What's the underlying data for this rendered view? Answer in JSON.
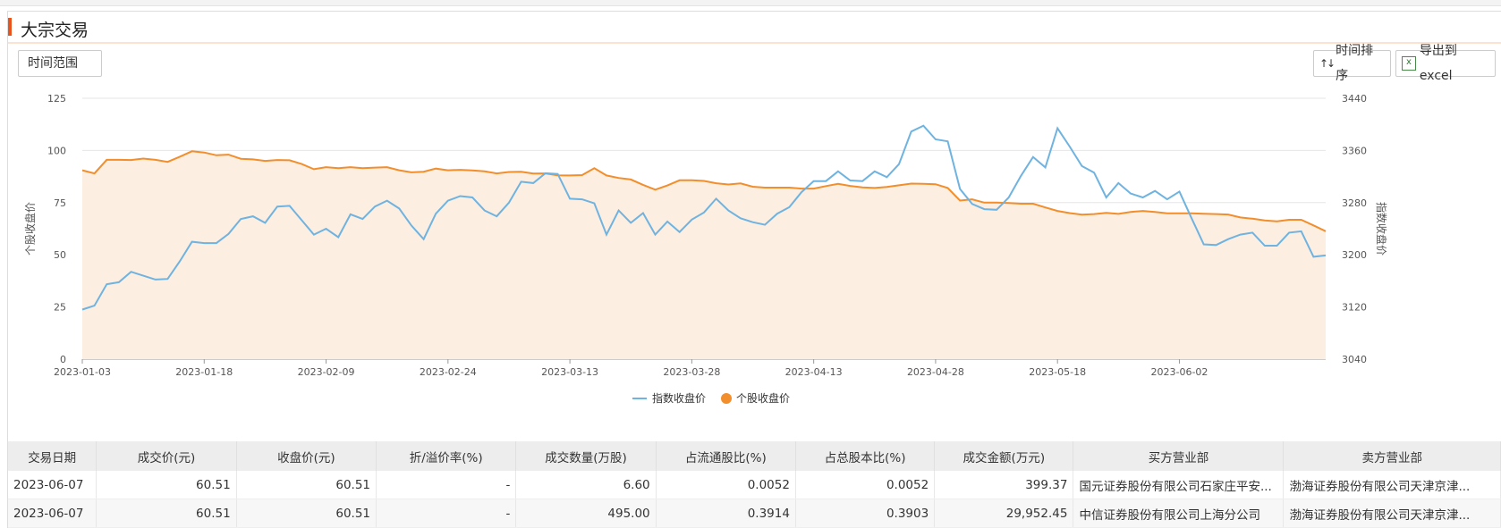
{
  "title": "大宗交易",
  "buttons": {
    "time_range": "时间范围",
    "sort": "时间排序",
    "export": "导出到excel"
  },
  "colors": {
    "accent": "#e8541e",
    "index_line": "#6fb3e0",
    "stock_line": "#f28e2b",
    "stock_area": "#fdeee2"
  },
  "chart_data": {
    "type": "line",
    "y_left": {
      "label": "个股收盘价",
      "range": [
        0,
        125
      ],
      "ticks": [
        0,
        25,
        50,
        75,
        100,
        125
      ]
    },
    "y_right": {
      "label": "指数收盘价",
      "range": [
        3040,
        3440
      ],
      "ticks": [
        3040,
        3120,
        3200,
        3280,
        3360,
        3440
      ]
    },
    "x_tick_labels": [
      "2023-01-03",
      "2023-01-18",
      "2023-02-09",
      "2023-02-24",
      "2023-03-13",
      "2023-03-28",
      "2023-04-13",
      "2023-04-28",
      "2023-05-18",
      "2023-06-02"
    ],
    "x_tick_positions": [
      0,
      10,
      20,
      30,
      40,
      50,
      60,
      70,
      80,
      90
    ],
    "grid": true,
    "legend_placement": "bottom",
    "series": [
      {
        "name": "指数收盘价",
        "axis": "right",
        "values": [
          3116,
          3122,
          3155,
          3158,
          3174,
          3168,
          3162,
          3163,
          3190,
          3220,
          3218,
          3218,
          3232,
          3255,
          3259,
          3249,
          3274,
          3275,
          3253,
          3231,
          3240,
          3227,
          3262,
          3255,
          3274,
          3283,
          3271,
          3245,
          3224,
          3263,
          3283,
          3290,
          3288,
          3268,
          3259,
          3280,
          3312,
          3310,
          3325,
          3324,
          3286,
          3285,
          3279,
          3231,
          3268,
          3249,
          3264,
          3231,
          3251,
          3235,
          3254,
          3265,
          3286,
          3268,
          3256,
          3250,
          3246,
          3263,
          3273,
          3296,
          3313,
          3313,
          3328,
          3314,
          3313,
          3328,
          3319,
          3339,
          3389,
          3398,
          3377,
          3374,
          3301,
          3278,
          3270,
          3269,
          3288,
          3321,
          3350,
          3334,
          3394,
          3366,
          3336,
          3326,
          3288,
          3310,
          3294,
          3288,
          3298,
          3285,
          3297,
          3256,
          3216,
          3215,
          3224,
          3231,
          3234,
          3214,
          3214,
          3234,
          3236,
          3197,
          3199
        ]
      },
      {
        "name": "个股收盘价",
        "axis": "left",
        "values": [
          90.5,
          89.0,
          95.5,
          95.5,
          95.4,
          96.1,
          95.5,
          94.5,
          97.0,
          99.6,
          99.0,
          97.7,
          98.0,
          96.0,
          95.7,
          95.0,
          95.4,
          95.3,
          93.5,
          91.0,
          92.0,
          91.5,
          92.0,
          91.5,
          91.8,
          92.0,
          90.5,
          89.5,
          89.8,
          91.3,
          90.5,
          90.7,
          90.4,
          90.0,
          89.0,
          89.7,
          89.8,
          88.9,
          89.0,
          88.1,
          88.0,
          88.2,
          91.5,
          88.0,
          86.8,
          86.1,
          83.5,
          81.2,
          83.2,
          85.7,
          85.7,
          85.4,
          84.3,
          83.7,
          84.2,
          82.6,
          82.2,
          82.2,
          82.2,
          81.7,
          81.7,
          82.9,
          84.0,
          83.0,
          82.3,
          82.0,
          82.5,
          83.3,
          84.1,
          84.0,
          83.8,
          82.0,
          76.0,
          76.6,
          75.0,
          75.0,
          74.8,
          74.5,
          74.5,
          72.7,
          71.0,
          70.0,
          69.2,
          69.5,
          70.1,
          69.6,
          70.5,
          71.0,
          70.5,
          69.9,
          69.9,
          69.9,
          69.7,
          69.5,
          69.3,
          67.9,
          67.3,
          66.5,
          66.0,
          66.8,
          66.8,
          64.1,
          61.3
        ]
      }
    ]
  },
  "table": {
    "columns": [
      "交易日期",
      "成交价(元)",
      "收盘价(元)",
      "折/溢价率(%)",
      "成交数量(万股)",
      "占流通股比(%)",
      "占总股本比(%)",
      "成交金额(万元)",
      "买方营业部",
      "卖方营业部"
    ],
    "rows": [
      [
        "2023-06-07",
        "60.51",
        "60.51",
        "-",
        "6.60",
        "0.0052",
        "0.0052",
        "399.37",
        "国元证券股份有限公司石家庄平安...",
        "渤海证券股份有限公司天津京津..."
      ],
      [
        "2023-06-07",
        "60.51",
        "60.51",
        "-",
        "495.00",
        "0.3914",
        "0.3903",
        "29,952.45",
        "中信证券股份有限公司上海分公司",
        "渤海证券股份有限公司天津京津..."
      ]
    ]
  }
}
